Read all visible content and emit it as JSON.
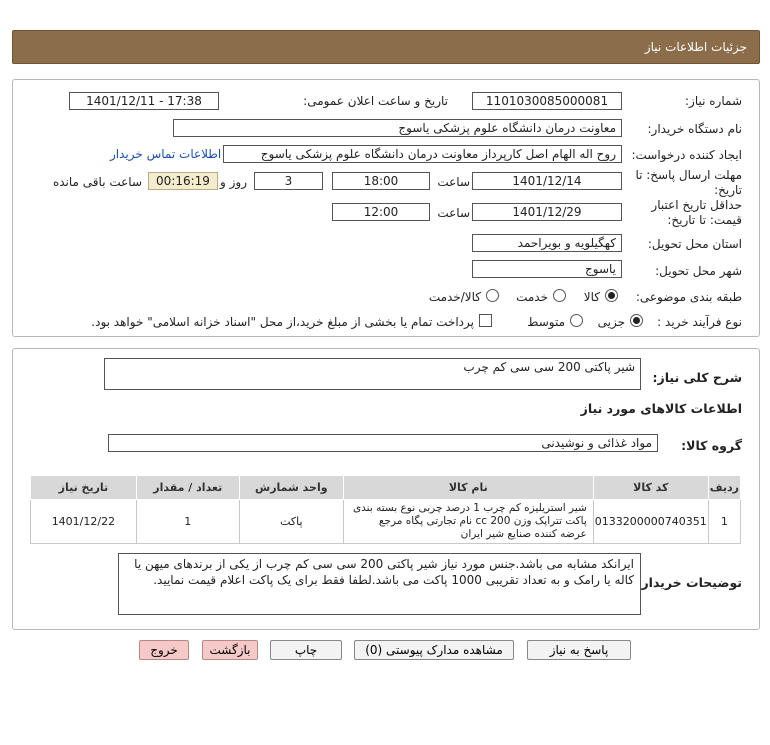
{
  "header": {
    "title": "جزئیات اطلاعات نیاز"
  },
  "form": {
    "need_number_label": "شماره نیاز:",
    "need_number": "1101030085000081",
    "announce_label": "تاریخ و ساعت اعلان عمومی:",
    "announce_value": "1401/12/11 - 17:38",
    "buyer_org_label": "نام دستگاه خریدار:",
    "buyer_org": "معاونت درمان دانشگاه علوم پزشکی یاسوج",
    "creator_label": "ایجاد کننده درخواست:",
    "creator": "روح اله الهام اصل کارپرداز معاونت درمان دانشگاه علوم پزشکی یاسوج",
    "contact_link": "اطلاعات تماس خریدار",
    "deadline_label_1": "مهلت ارسال پاسخ: تا",
    "deadline_label_2": "تاریخ:",
    "deadline_date": "1401/12/14",
    "time_label": "ساعت",
    "deadline_time": "18:00",
    "days_value": "3",
    "days_label": "روز و",
    "remaining_time": "00:16:19",
    "remaining_label": "ساعت باقی مانده",
    "validity_label_1": "حداقل تاریخ اعتبار",
    "validity_label_2": "قیمت: تا تاریخ:",
    "validity_date": "1401/12/29",
    "validity_time": "12:00",
    "province_label": "استان محل تحویل:",
    "province": "کهگیلویه و بویراحمد",
    "city_label": "شهر محل تحویل:",
    "city": "یاسوج",
    "category_label": "طبقه بندی موضوعی:",
    "category_options": [
      "کالا",
      "خدمت",
      "کالا/خدمت"
    ],
    "process_label": "نوع فرآیند خرید :",
    "process_options": [
      "جزیی",
      "متوسط"
    ],
    "treasury_note": "پرداخت تمام یا بخشی از مبلغ خرید،از محل \"اسناد خزانه اسلامی\" خواهد بود."
  },
  "summary": {
    "label": "شرح کلی نیاز:",
    "value": "شیر پاکتی 200 سی سی کم چرب"
  },
  "goods": {
    "section_title": "اطلاعات کالاهای مورد نیاز",
    "group_label": "گروه کالا:",
    "group_value": "مواد غذائی و نوشیدنی"
  },
  "table": {
    "headers": [
      "ردیف",
      "کد کالا",
      "نام کالا",
      "واحد شمارش",
      "تعداد / مقدار",
      "تاریخ نیاز"
    ],
    "rows": [
      {
        "row": "1",
        "code": "0133200000740351",
        "name": "شیر استریلیزه کم چرب 1 درصد چربی نوع بسته بندی پاکت تتراپک وزن 200 cc نام تجارتی پگاه مرجع عرضه کننده صنایع شیر ایران",
        "unit": "پاکت",
        "qty": "1",
        "date": "1401/12/22"
      }
    ]
  },
  "buyer_notes": {
    "label": "توضیحات خریدار:",
    "text": "ایرانکد مشابه می باشد.جنس مورد نیاز شیر پاکتی 200 سی سی کم چرب از یکی از برندهای  میهن یا کاله یا رامک و به تعداد تقریبی 1000 پاکت می باشد.لطفا فقط برای یک پاکت اعلام قیمت نمایید."
  },
  "buttons": {
    "reply": "پاسخ به نیاز",
    "docs": "مشاهده مدارک پیوستی (0)",
    "print": "چاپ",
    "back": "بازگشت",
    "exit": "خروج"
  }
}
